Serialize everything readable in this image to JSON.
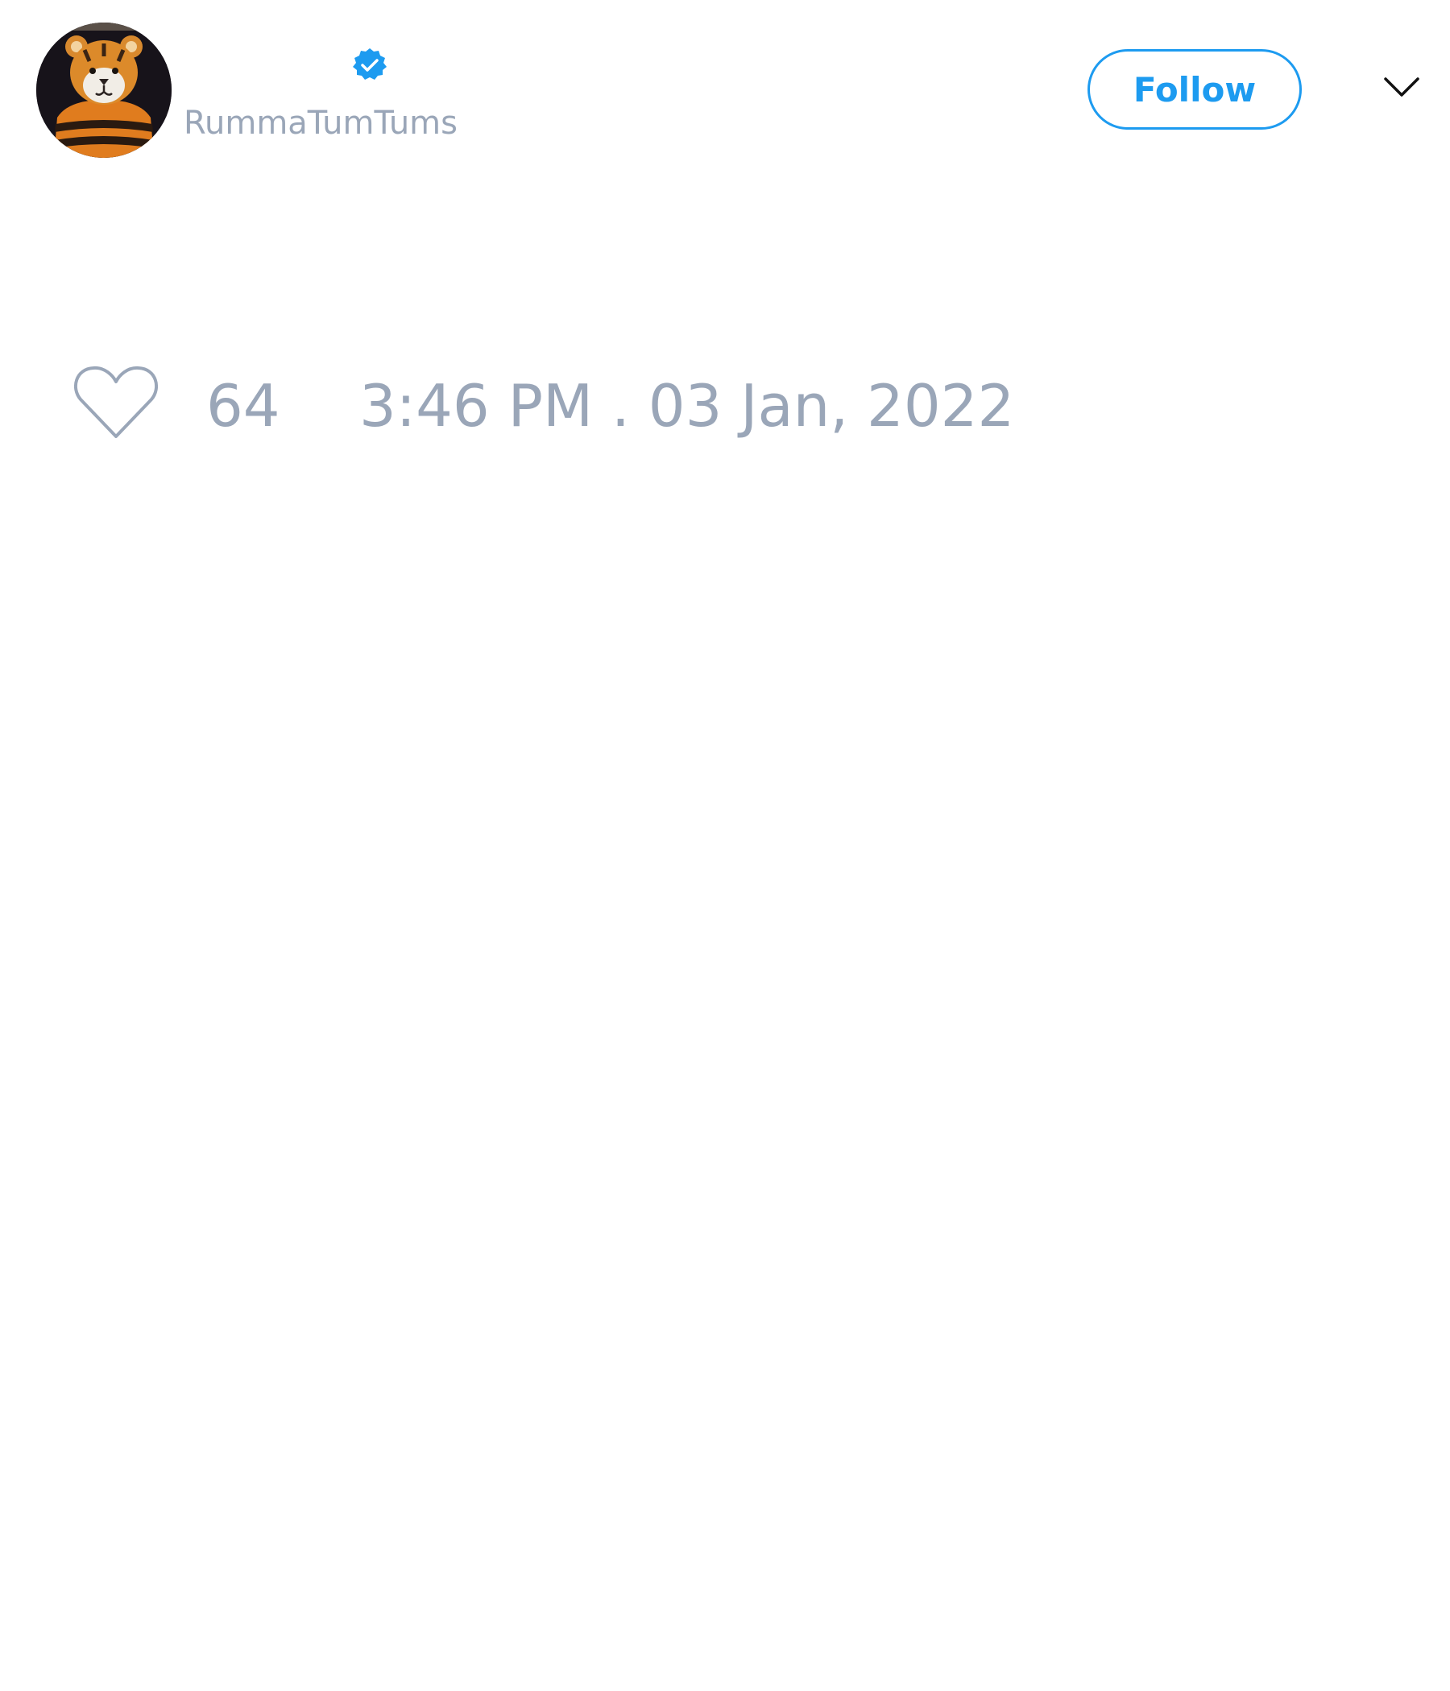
{
  "author": {
    "handle": "RummaTumTums",
    "avatar_icon": "tiger-plush-avatar",
    "verified_icon": "verified-badge-icon",
    "verified_color": "#1d9bf0"
  },
  "header": {
    "follow_label": "Follow",
    "menu_icon": "chevron-down-icon"
  },
  "engagement": {
    "like_icon": "heart-outline-icon",
    "like_count": "64",
    "timestamp": "3:46 PM . 03 Jan, 2022"
  },
  "colors": {
    "accent": "#1d9bf0",
    "muted_text": "#9aa6b8",
    "background": "#ffffff"
  }
}
